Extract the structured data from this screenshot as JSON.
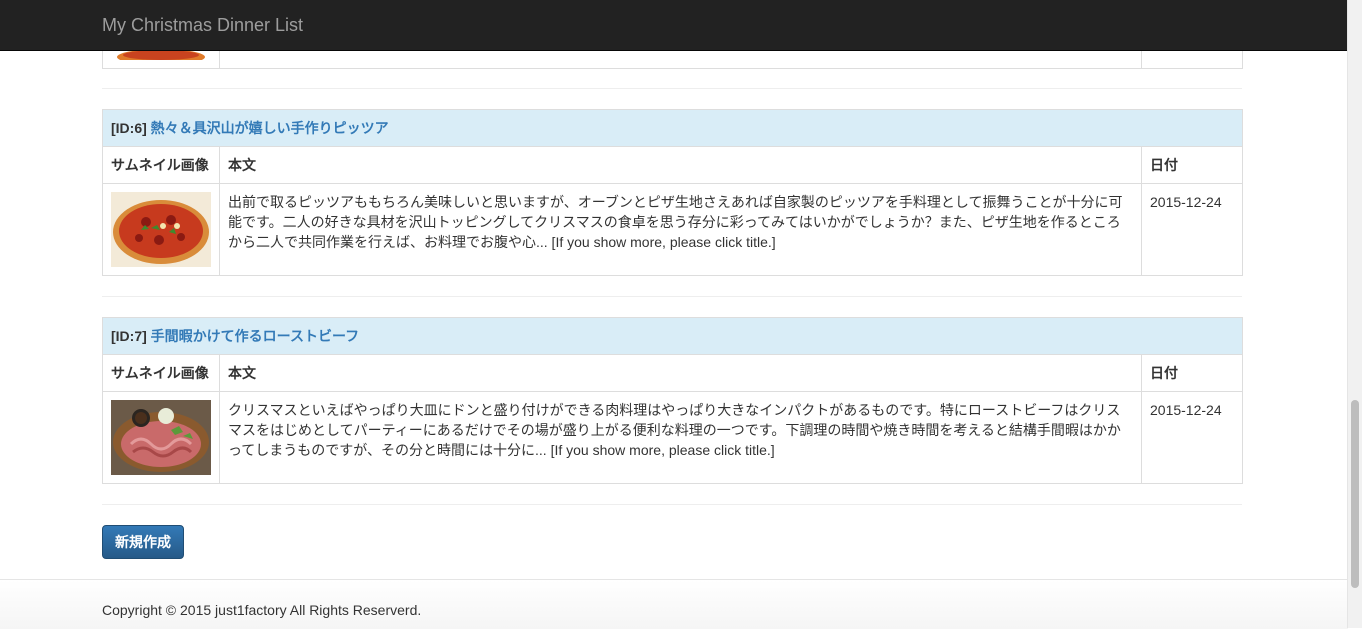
{
  "navbar": {
    "brand": "My Christmas Dinner List"
  },
  "table_headers": {
    "thumbnail": "サムネイル画像",
    "body": "本文",
    "date": "日付"
  },
  "posts": [
    {
      "id_label": "[ID:6]",
      "title": "熱々＆具沢山が嬉しい手作りピッツア",
      "thumbnail_icon": "pizza-image",
      "body_lines": [
        "出前で取るピッツアももちろん美味しいと思いますが、オーブンとピザ生地さえあれば自家製のピッツアを手料理として振舞うことが十分に可",
        "能です。二人の好きな具材を沢山トッピングしてクリスマスの食卓を思う存分に彩ってみてはいかがでしょうか？また、ピザ生地を作るところ",
        "から二人で共同作業を行えば、お料理でお腹や心... [If you show more, please click title.]"
      ],
      "date": "2015-12-24"
    },
    {
      "id_label": "[ID:7]",
      "title": "手間暇かけて作るローストビーフ",
      "thumbnail_icon": "roast-beef-image",
      "body_lines": [
        "クリスマスといえばやっぱり大皿にドンと盛り付けができる肉料理はやっぱり大きなインパクトがあるものです。特にローストビーフはクリス",
        "マスをはじめとしてパーティーにあるだけでその場が盛り上がる便利な料理の一つです。下調理の時間や焼き時間を考えると結構手間暇はかか",
        "ってしまうものですが、その分と時間には十分に... [If you show more, please click title.]"
      ],
      "date": "2015-12-24"
    }
  ],
  "new_button": "新規作成",
  "footer": {
    "copyright": "Copyright © 2015 just1factory All Rights Reserverd."
  },
  "colors": {
    "navbar_bg": "#222222",
    "title_row_bg": "#d9edf7",
    "link": "#337ab7",
    "button_bg": "#2e6da4"
  }
}
